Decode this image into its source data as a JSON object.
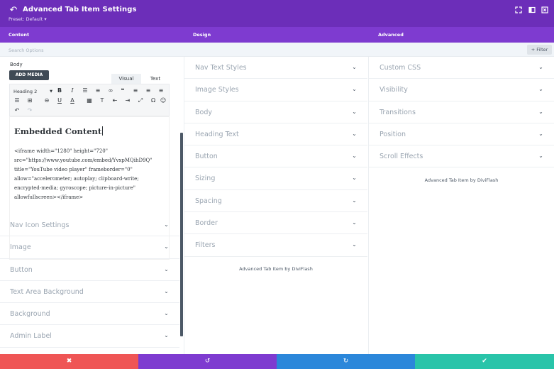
{
  "header": {
    "title": "Advanced Tab Item Settings",
    "preset": "Preset: Default ▾",
    "bg": "#6c2eb9"
  },
  "tabs": [
    {
      "label": "Content"
    },
    {
      "label": "Design"
    },
    {
      "label": "Advanced"
    }
  ],
  "search": {
    "placeholder": "Search Options",
    "filter_label": "+ Filter"
  },
  "content": {
    "body_label": "Body",
    "add_media": "ADD MEDIA",
    "visual_tab": "Visual",
    "text_tab": "Text",
    "heading_select": "Heading 2",
    "editor_heading": "Embedded Content",
    "editor_code": "<iframe width=\"1280\" height=\"720\" src=\"https://www.youtube.com/embed/YvxpMQihD9Q\" title=\"YouTube video player\" frameborder=\"0\" allow=\"accelerometer; autoplay; clipboard-write; encrypted-media; gyroscope; picture-in-picture\" allowfullscreen></iframe>",
    "sections": [
      "Nav Icon Settings",
      "Image",
      "Button",
      "Text Area Background",
      "Background",
      "Admin Label"
    ]
  },
  "design": {
    "sections": [
      "Nav Text Styles",
      "Image Styles",
      "Body",
      "Heading Text",
      "Button",
      "Sizing",
      "Spacing",
      "Border",
      "Filters"
    ],
    "credit": "Advanced Tab Item by DiviFlash"
  },
  "advanced": {
    "sections": [
      "Custom CSS",
      "Visibility",
      "Transitions",
      "Position",
      "Scroll Effects"
    ],
    "credit": "Advanced Tab Item by DiviFlash"
  },
  "footer": {
    "colors": {
      "cancel": "#ef5555",
      "undo": "#7e3bd0",
      "redo": "#2b87da",
      "save": "#29c4a9"
    }
  }
}
